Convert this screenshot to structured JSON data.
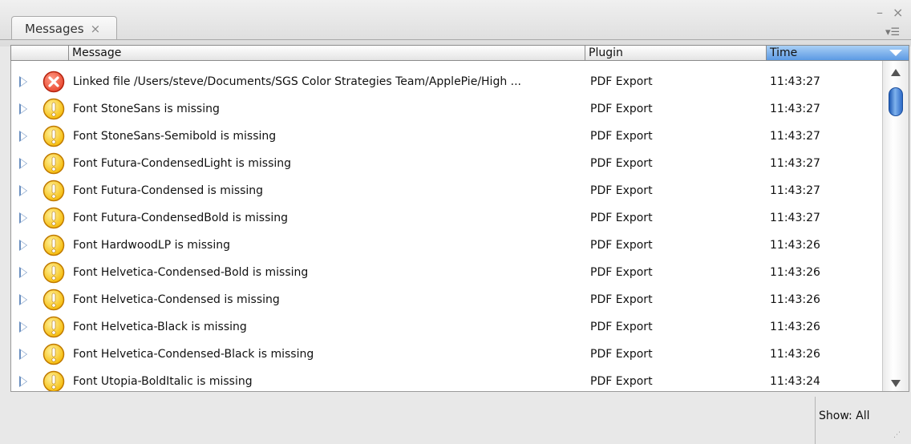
{
  "panel": {
    "tab_label": "Messages",
    "tab_close_glyph": "×",
    "minimize_glyph": "–",
    "close_glyph": "×",
    "menu_glyph": "▾☰"
  },
  "header": {
    "col_message": "Message",
    "col_plugin": "Plugin",
    "col_time": "Time",
    "sorted_column": "Time",
    "sort_color": "#5c9ae4"
  },
  "rows": [
    {
      "severity": "error",
      "icon": "error-icon",
      "message": "Linked file /Users/steve/Documents/SGS Color Strategies Team/ApplePie/High ...",
      "plugin": "PDF Export",
      "time": "11:43:27"
    },
    {
      "severity": "warning",
      "icon": "warning-icon",
      "message": "Font StoneSans is missing",
      "plugin": "PDF Export",
      "time": "11:43:27"
    },
    {
      "severity": "warning",
      "icon": "warning-icon",
      "message": "Font StoneSans-Semibold is missing",
      "plugin": "PDF Export",
      "time": "11:43:27"
    },
    {
      "severity": "warning",
      "icon": "warning-icon",
      "message": "Font Futura-CondensedLight is missing",
      "plugin": "PDF Export",
      "time": "11:43:27"
    },
    {
      "severity": "warning",
      "icon": "warning-icon",
      "message": "Font Futura-Condensed is missing",
      "plugin": "PDF Export",
      "time": "11:43:27"
    },
    {
      "severity": "warning",
      "icon": "warning-icon",
      "message": "Font Futura-CondensedBold is missing",
      "plugin": "PDF Export",
      "time": "11:43:27"
    },
    {
      "severity": "warning",
      "icon": "warning-icon",
      "message": "Font HardwoodLP is missing",
      "plugin": "PDF Export",
      "time": "11:43:26"
    },
    {
      "severity": "warning",
      "icon": "warning-icon",
      "message": "Font Helvetica-Condensed-Bold is missing",
      "plugin": "PDF Export",
      "time": "11:43:26"
    },
    {
      "severity": "warning",
      "icon": "warning-icon",
      "message": "Font Helvetica-Condensed is missing",
      "plugin": "PDF Export",
      "time": "11:43:26"
    },
    {
      "severity": "warning",
      "icon": "warning-icon",
      "message": "Font Helvetica-Black is missing",
      "plugin": "PDF Export",
      "time": "11:43:26"
    },
    {
      "severity": "warning",
      "icon": "warning-icon",
      "message": "Font Helvetica-Condensed-Black is missing",
      "plugin": "PDF Export",
      "time": "11:43:26"
    },
    {
      "severity": "warning",
      "icon": "warning-icon",
      "message": "Font Utopia-BoldItalic is missing",
      "plugin": "PDF Export",
      "time": "11:43:24"
    }
  ],
  "status": {
    "filter_label": "Show: All"
  },
  "colors": {
    "error": "#e8452c",
    "warning": "#f5b800",
    "disclosure": "#6a8fc0"
  }
}
